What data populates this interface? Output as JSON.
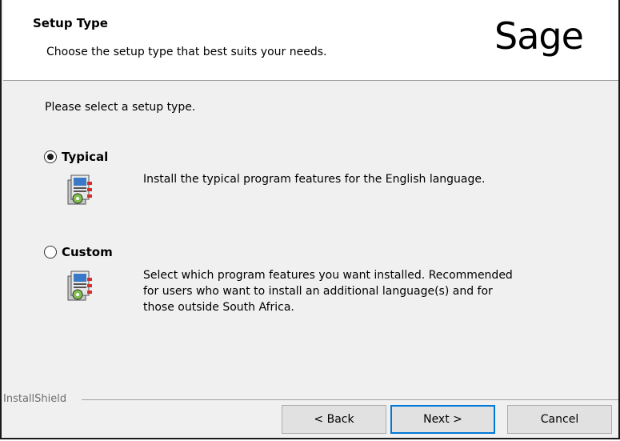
{
  "header": {
    "title": "Setup Type",
    "subtitle": "Choose the setup type that best suits your needs.",
    "logo_text": "Sage"
  },
  "main": {
    "prompt": "Please select a setup type.",
    "options": [
      {
        "label": "Typical",
        "selected": true,
        "icon": "setup-package-icon",
        "description": "Install the typical program features for the English language."
      },
      {
        "label": "Custom",
        "selected": false,
        "icon": "setup-package-icon",
        "description_lines": [
          "Select which program features you want installed. Recommended",
          "for users who want to install an additional language(s) and for",
          "those outside South Africa."
        ]
      }
    ]
  },
  "footer": {
    "group_label": "InstallShield",
    "back_label": "< Back",
    "next_label": "Next >",
    "cancel_label": "Cancel"
  },
  "colors": {
    "dialog_bg": "#f0f0f0",
    "header_bg": "#ffffff",
    "default_button_border": "#0078d7"
  }
}
